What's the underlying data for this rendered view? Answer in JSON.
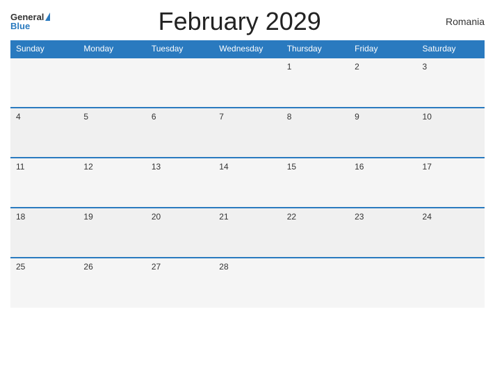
{
  "header": {
    "logo_general": "General",
    "logo_blue": "Blue",
    "title": "February 2029",
    "country": "Romania"
  },
  "calendar": {
    "days_of_week": [
      "Sunday",
      "Monday",
      "Tuesday",
      "Wednesday",
      "Thursday",
      "Friday",
      "Saturday"
    ],
    "weeks": [
      [
        "",
        "",
        "",
        "",
        "1",
        "2",
        "3"
      ],
      [
        "4",
        "5",
        "6",
        "7",
        "8",
        "9",
        "10"
      ],
      [
        "11",
        "12",
        "13",
        "14",
        "15",
        "16",
        "17"
      ],
      [
        "18",
        "19",
        "20",
        "21",
        "22",
        "23",
        "24"
      ],
      [
        "25",
        "26",
        "27",
        "28",
        "",
        "",
        ""
      ]
    ]
  }
}
